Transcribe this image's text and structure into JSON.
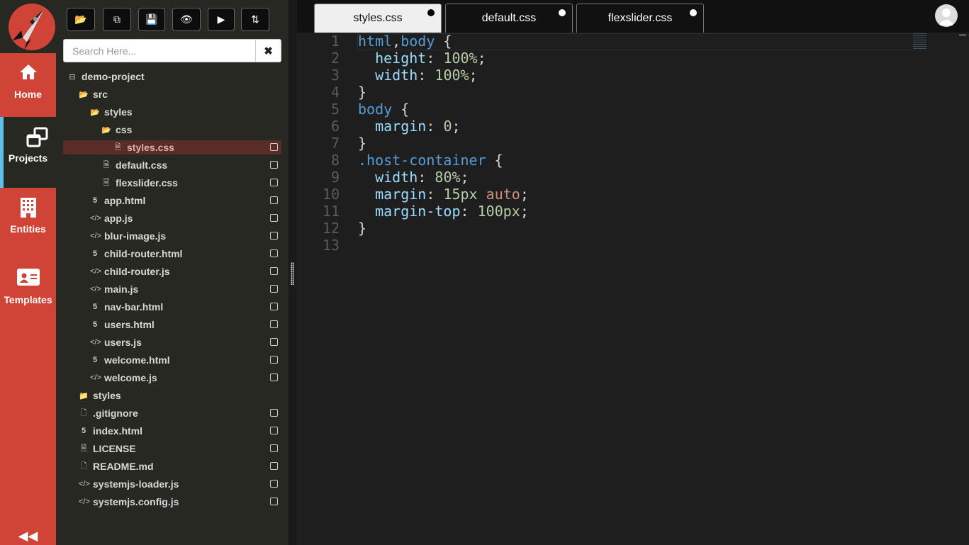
{
  "nav": {
    "items": [
      {
        "label": "Home",
        "icon": "home-icon",
        "active": false
      },
      {
        "label": "Projects",
        "icon": "projects-icon",
        "active": true
      },
      {
        "label": "Entities",
        "icon": "building-icon",
        "active": false
      },
      {
        "label": "Templates",
        "icon": "id-card-icon",
        "active": false
      }
    ],
    "collapse_icon": "double-chevron-left-icon",
    "colors": {
      "nav_bg": "#cf4436",
      "active_accent": "#5bc0eb"
    }
  },
  "toolbar": {
    "buttons": [
      "open-folder-icon",
      "copy-icon",
      "save-icon",
      "preview-eye-icon",
      "run-play-icon",
      "sync-icon"
    ]
  },
  "search": {
    "placeholder": "Search Here...",
    "value": "",
    "clear_icon": "times-icon"
  },
  "tree": [
    {
      "name": "demo-project",
      "icon": "minus-square-icon",
      "level": 0,
      "check": false
    },
    {
      "name": "src",
      "icon": "folder-open-icon",
      "level": 1,
      "check": false
    },
    {
      "name": "styles",
      "icon": "folder-open-icon",
      "level": 2,
      "check": false
    },
    {
      "name": "css",
      "icon": "folder-open-icon",
      "level": 3,
      "check": false
    },
    {
      "name": "styles.css",
      "icon": "file-icon",
      "level": 4,
      "check": true,
      "selected": true
    },
    {
      "name": "default.css",
      "icon": "file-icon",
      "level": 3,
      "check": true
    },
    {
      "name": "flexslider.css",
      "icon": "file-icon",
      "level": 3,
      "check": true
    },
    {
      "name": "app.html",
      "icon": "html5-icon",
      "level": 2,
      "check": true
    },
    {
      "name": "app.js",
      "icon": "code-icon",
      "level": 2,
      "check": true
    },
    {
      "name": "blur-image.js",
      "icon": "code-icon",
      "level": 2,
      "check": true
    },
    {
      "name": "child-router.html",
      "icon": "html5-icon",
      "level": 2,
      "check": true
    },
    {
      "name": "child-router.js",
      "icon": "code-icon",
      "level": 2,
      "check": true
    },
    {
      "name": "main.js",
      "icon": "code-icon",
      "level": 2,
      "check": true
    },
    {
      "name": "nav-bar.html",
      "icon": "html5-icon",
      "level": 2,
      "check": true
    },
    {
      "name": "users.html",
      "icon": "html5-icon",
      "level": 2,
      "check": true
    },
    {
      "name": "users.js",
      "icon": "code-icon",
      "level": 2,
      "check": true
    },
    {
      "name": "welcome.html",
      "icon": "html5-icon",
      "level": 2,
      "check": true
    },
    {
      "name": "welcome.js",
      "icon": "code-icon",
      "level": 2,
      "check": true
    },
    {
      "name": "styles",
      "icon": "folder-icon",
      "level": 1,
      "check": false
    },
    {
      "name": ".gitignore",
      "icon": "file-text-icon",
      "level": 1,
      "check": true
    },
    {
      "name": "index.html",
      "icon": "html5-icon",
      "level": 1,
      "check": true
    },
    {
      "name": "LICENSE",
      "icon": "file-icon",
      "level": 1,
      "check": true
    },
    {
      "name": "README.md",
      "icon": "file-text-icon",
      "level": 1,
      "check": true
    },
    {
      "name": "systemjs-loader.js",
      "icon": "code-icon",
      "level": 1,
      "check": true
    },
    {
      "name": "systemjs.config.js",
      "icon": "code-icon",
      "level": 1,
      "check": true
    }
  ],
  "tabs": [
    {
      "label": "styles.css",
      "active": true
    },
    {
      "label": "default.css",
      "active": false
    },
    {
      "label": "flexslider.css",
      "active": false
    }
  ],
  "editor": {
    "lines": [
      [
        [
          "k",
          "html"
        ],
        [
          "",
          ","
        ],
        [
          "k",
          "body"
        ],
        [
          "",
          " {"
        ]
      ],
      [
        [
          "",
          "  "
        ],
        [
          "p",
          "height"
        ],
        [
          "",
          ": "
        ],
        [
          "n",
          "100%"
        ],
        [
          "",
          ";"
        ]
      ],
      [
        [
          "",
          "  "
        ],
        [
          "p",
          "width"
        ],
        [
          "",
          ": "
        ],
        [
          "n",
          "100%"
        ],
        [
          "",
          ";"
        ]
      ],
      [
        [
          "",
          "}"
        ]
      ],
      [
        [
          "k",
          "body"
        ],
        [
          "",
          " {"
        ]
      ],
      [
        [
          "",
          "  "
        ],
        [
          "p",
          "margin"
        ],
        [
          "",
          ": "
        ],
        [
          "n",
          "0"
        ],
        [
          "",
          ";"
        ]
      ],
      [
        [
          "",
          "}"
        ]
      ],
      [
        [
          "k",
          ".host-container"
        ],
        [
          "",
          " {"
        ]
      ],
      [
        [
          "",
          "  "
        ],
        [
          "p",
          "width"
        ],
        [
          "",
          ": "
        ],
        [
          "n",
          "80%"
        ],
        [
          "",
          ";"
        ]
      ],
      [
        [
          "",
          "  "
        ],
        [
          "p",
          "margin"
        ],
        [
          "",
          ": "
        ],
        [
          "n",
          "15px"
        ],
        [
          "",
          " "
        ],
        [
          "v",
          "auto"
        ],
        [
          "",
          ";"
        ]
      ],
      [
        [
          "",
          "  "
        ],
        [
          "p",
          "margin-top"
        ],
        [
          "",
          ": "
        ],
        [
          "n",
          "100px"
        ],
        [
          "",
          ";"
        ]
      ],
      [
        [
          "",
          "}"
        ]
      ],
      []
    ],
    "colors": {
      "keyword": "#569cd6",
      "property": "#9cdcfe",
      "number": "#b5cea8",
      "value": "#ce9178"
    }
  }
}
